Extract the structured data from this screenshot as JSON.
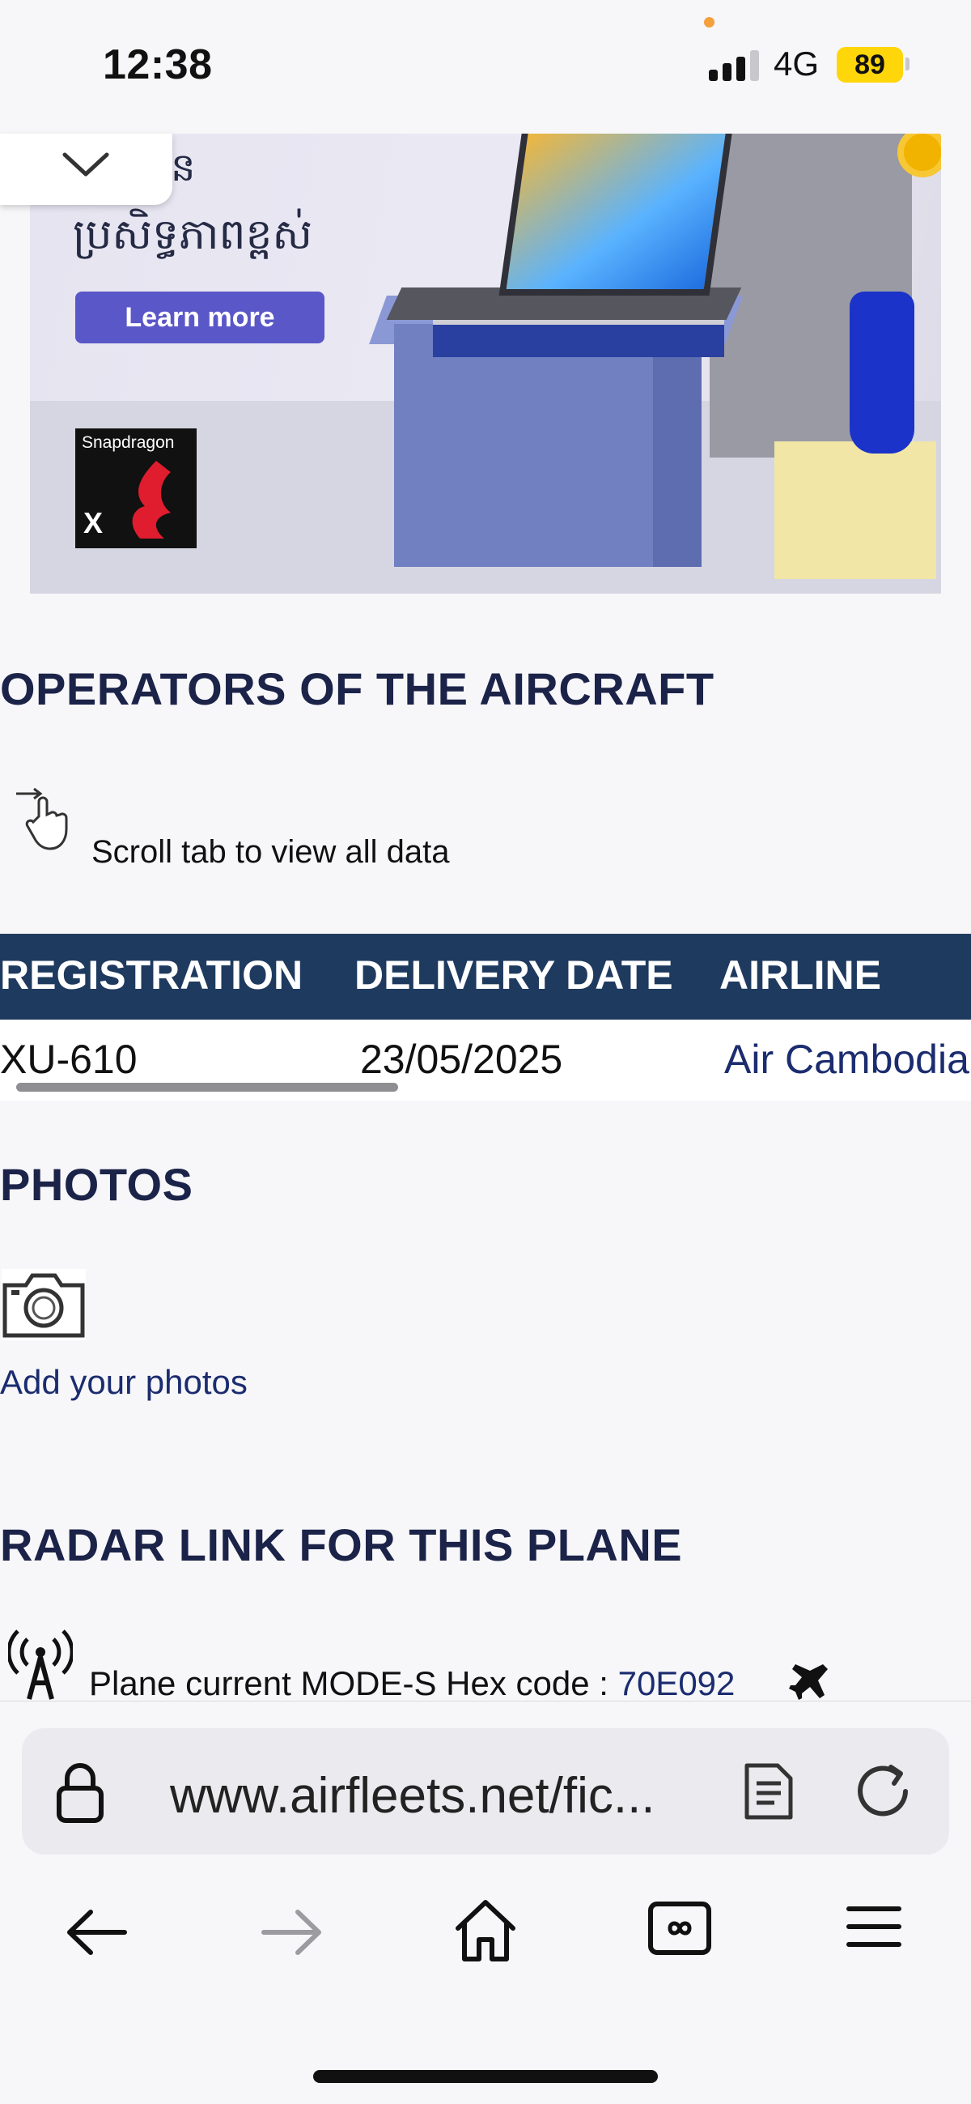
{
  "status_bar": {
    "time": "12:38",
    "network": "4G",
    "battery": "89",
    "battery_color": "#ffd60a"
  },
  "ad": {
    "khmer_line1": "ប្រូបង្កើន",
    "khmer_line2": "ប្រសិទ្ធភាពខ្ពស់",
    "cta": "Learn more",
    "brand": "Snapdragon",
    "brand_mark": "X"
  },
  "operators": {
    "title": "OPERATORS OF THE AIRCRAFT",
    "scroll_hint": "Scroll tab to view all data",
    "columns": [
      "REGISTRATION",
      "DELIVERY DATE",
      "AIRLINE"
    ],
    "rows": [
      {
        "registration": "XU-610",
        "delivery_date": "23/05/2025",
        "airline": "Air Cambodia"
      }
    ]
  },
  "photos": {
    "title": "PHOTOS",
    "add_link": "Add your photos"
  },
  "radar": {
    "title": "RADAR LINK FOR THIS PLANE",
    "modes_label": "Plane current MODE-S Hex code : ",
    "modes_code": "70E092"
  },
  "browser": {
    "url": "www.airfleets.net/fic..."
  },
  "colors": {
    "heading": "#1b2349",
    "table_header": "#1f3a5f",
    "link": "#1b2c6f",
    "ad_button": "#5a57c8"
  }
}
